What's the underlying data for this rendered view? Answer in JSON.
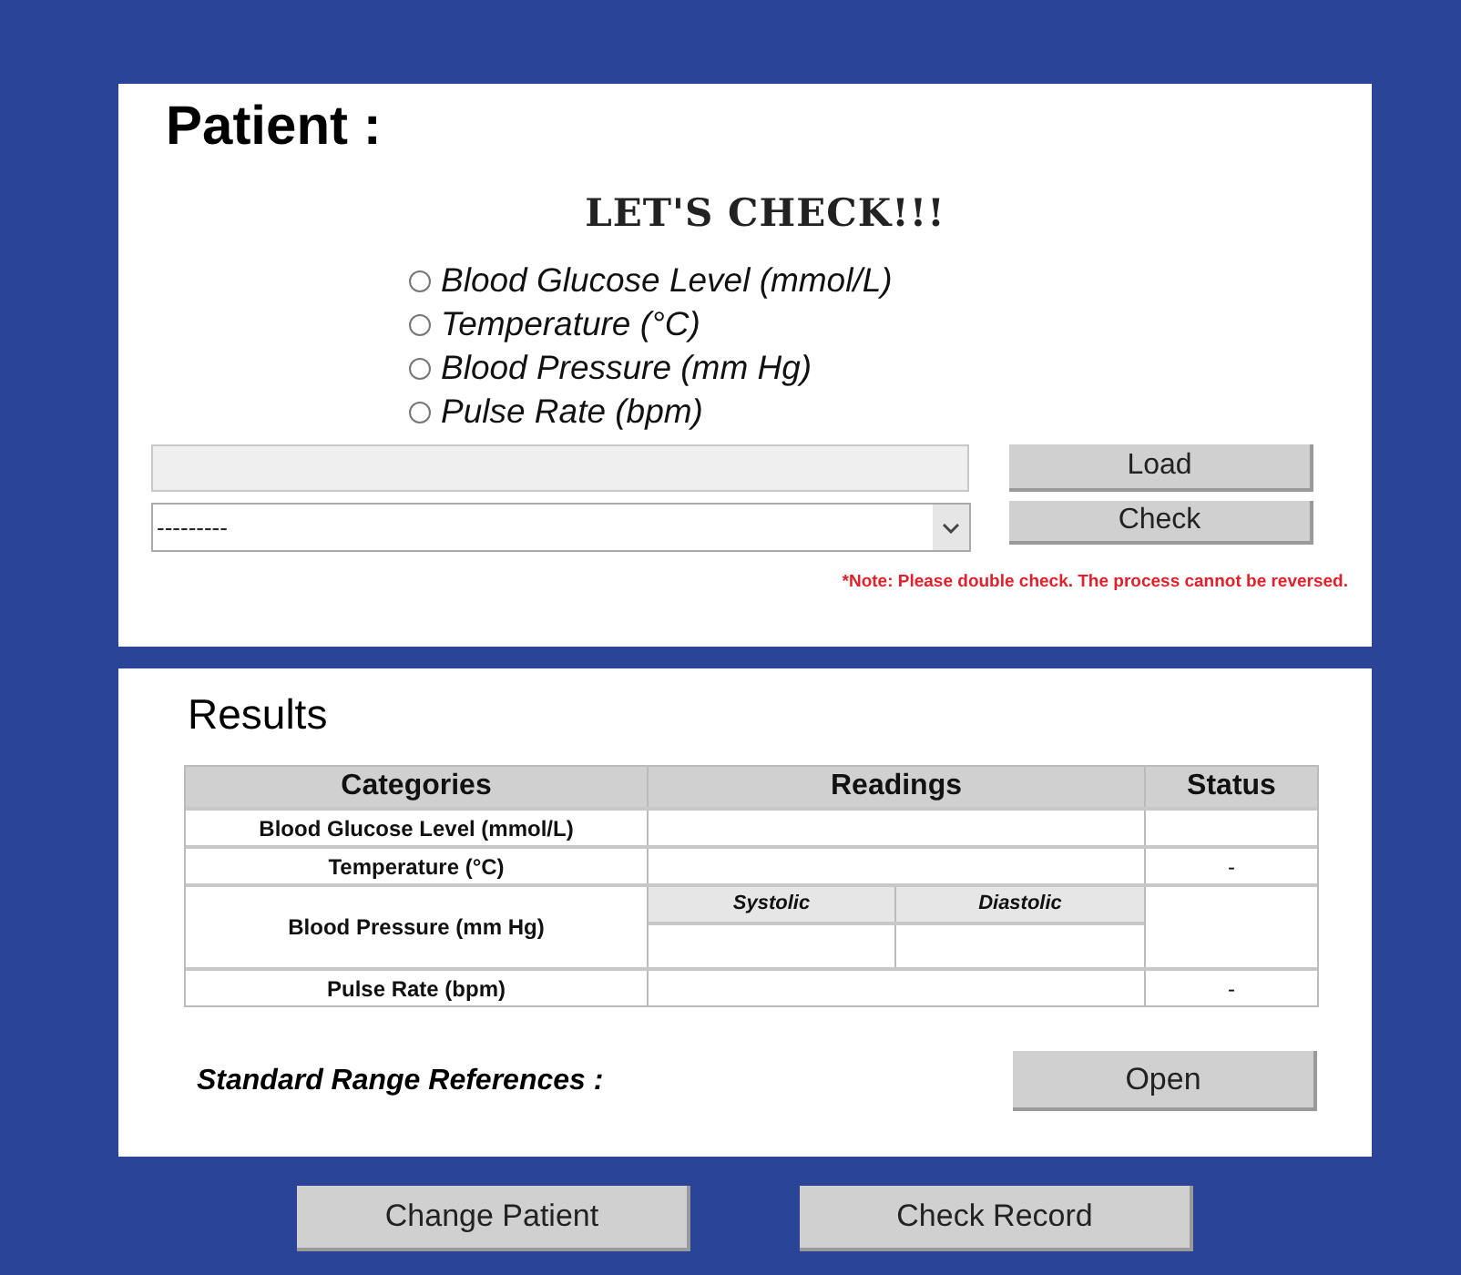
{
  "patient": {
    "label": "Patient :"
  },
  "check": {
    "title": "LET'S CHECK!!!",
    "options": [
      {
        "label": "Blood Glucose Level (mmol/L)",
        "selected": false
      },
      {
        "label": "Temperature (°C)",
        "selected": false
      },
      {
        "label": "Blood Pressure (mm Hg)",
        "selected": false
      },
      {
        "label": "Pulse Rate (bpm)",
        "selected": false
      }
    ],
    "dropdown": {
      "value": "---------"
    },
    "buttons": [
      "Load",
      "Check"
    ],
    "note": "*Note: Please double check. The process cannot be reversed."
  },
  "results": {
    "title": "Results",
    "table": {
      "columns": [
        "Categories",
        "Readings",
        "Status"
      ],
      "rows": [
        {
          "kind": "single",
          "category": "Blood Glucose Level (mmol/L)"
        },
        {
          "kind": "single",
          "category": "Temperature (°C)",
          "status": "-"
        },
        {
          "kind": "split",
          "category": "Blood Pressure (mm Hg)",
          "subcolumns": [
            "Systolic",
            "Diastolic"
          ]
        },
        {
          "kind": "single",
          "category": "Pulse Rate (bpm)",
          "status": "-"
        }
      ]
    },
    "references": {
      "label": "Standard Range References :",
      "button": "Open"
    }
  },
  "footer_buttons": [
    "Change Patient",
    "Check Record"
  ]
}
